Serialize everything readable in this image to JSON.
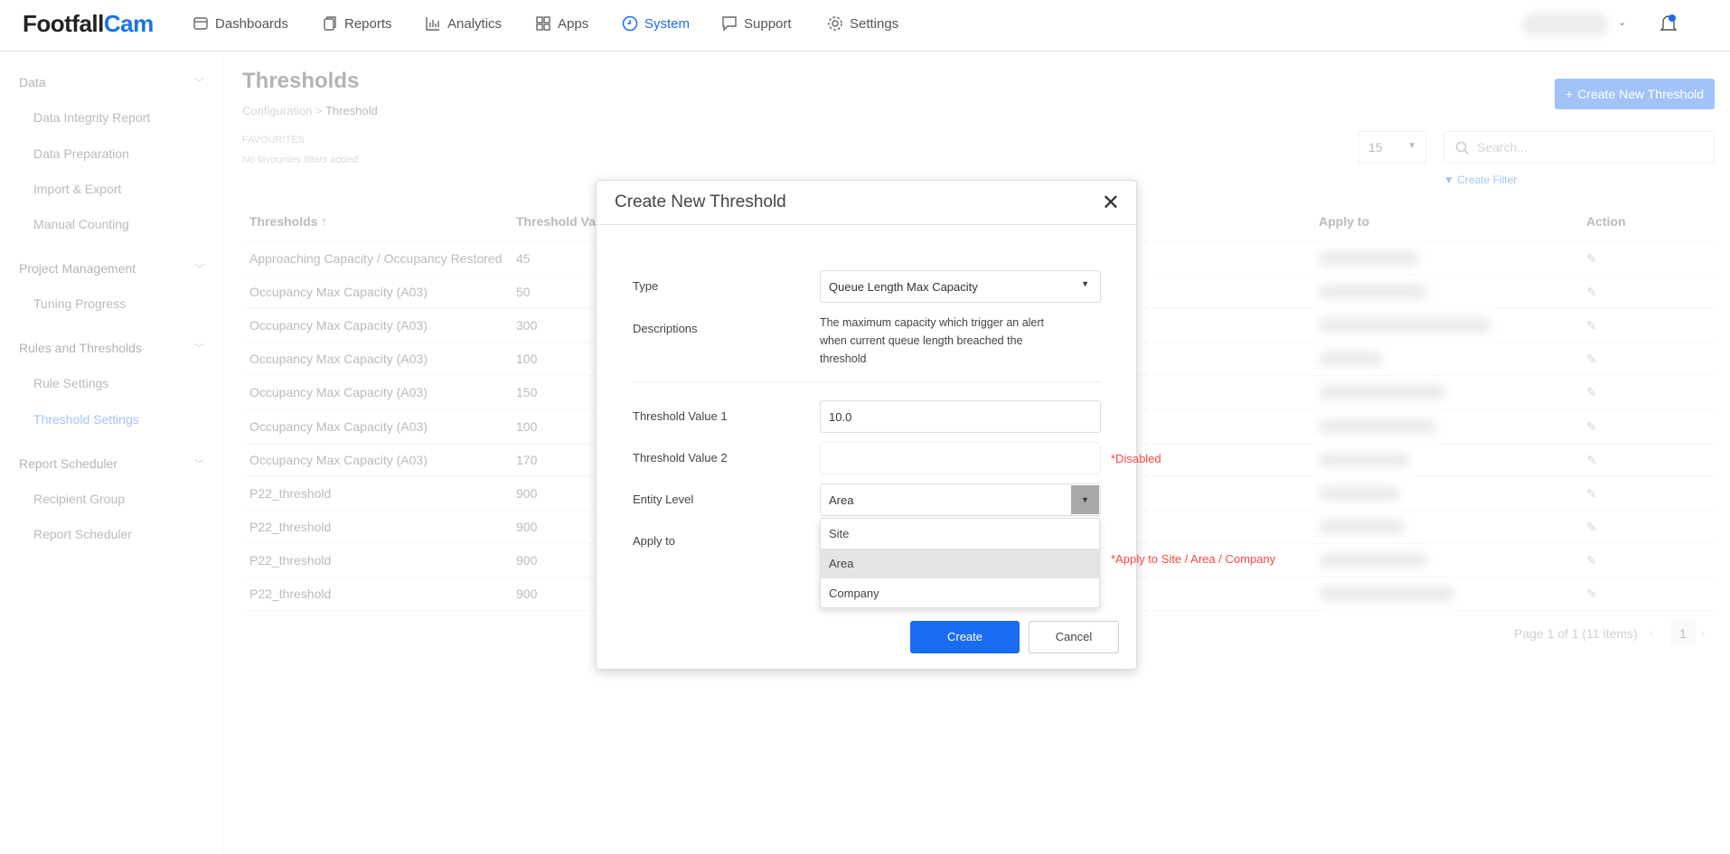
{
  "header": {
    "logo_a": "Footfall",
    "logo_b": "Cam",
    "nav": [
      {
        "label": "Dashboards",
        "icon": "dashboard-icon"
      },
      {
        "label": "Reports",
        "icon": "reports-icon"
      },
      {
        "label": "Analytics",
        "icon": "analytics-icon"
      },
      {
        "label": "Apps",
        "icon": "apps-icon"
      },
      {
        "label": "System",
        "icon": "system-icon",
        "active": true
      },
      {
        "label": "Support",
        "icon": "support-icon"
      },
      {
        "label": "Settings",
        "icon": "gear-icon"
      }
    ]
  },
  "sidebar": {
    "groups": [
      {
        "label": "Data",
        "items": [
          "Data Integrity Report",
          "Data Preparation",
          "Import & Export",
          "Manual Counting"
        ]
      },
      {
        "label": "Project Management",
        "items": [
          "Tuning Progress"
        ]
      },
      {
        "label": "Rules and Thresholds",
        "items": [
          "Rule Settings",
          "Threshold Settings"
        ]
      },
      {
        "label": "Report Scheduler",
        "items": [
          "Recipient Group",
          "Report Scheduler"
        ]
      }
    ],
    "active": "Threshold Settings"
  },
  "main": {
    "title": "Thresholds",
    "breadcrumb": [
      "Configuration",
      ">",
      "Threshold"
    ],
    "favourites_label": "FAVOURITES",
    "no_favourites": "No favourites filters added.",
    "create_button": "Create New Threshold",
    "page_size": "15",
    "search_placeholder": "Search...",
    "create_filter": "Create Filter",
    "columns": [
      "Thresholds",
      "Threshold Value",
      "Apply to",
      "Action"
    ],
    "rows": [
      [
        "Approaching Capacity / Occupancy Restored",
        "45"
      ],
      [
        "Occupancy Max Capacity (A03)",
        "50"
      ],
      [
        "Occupancy Max Capacity (A03)",
        "300"
      ],
      [
        "Occupancy Max Capacity (A03)",
        "100"
      ],
      [
        "Occupancy Max Capacity (A03)",
        "150"
      ],
      [
        "Occupancy Max Capacity (A03)",
        "100"
      ],
      [
        "Occupancy Max Capacity (A03)",
        "170"
      ],
      [
        "P22_threshold",
        "900"
      ],
      [
        "P22_threshold",
        "900"
      ],
      [
        "P22_threshold",
        "900"
      ],
      [
        "P22_threshold",
        "900"
      ]
    ],
    "pagination": "Page 1 of 1 (11 items)",
    "current_page": "1"
  },
  "dialog": {
    "title": "Create New Threshold",
    "type_label": "Type",
    "type_value": "Queue Length Max Capacity",
    "desc_label": "Descriptions",
    "desc_text": "The maximum capacity which trigger an alert when current queue length breached the threshold",
    "tv1_label": "Threshold Value 1",
    "tv1_value": "10.0",
    "tv2_label": "Threshold Value 2",
    "tv2_value": "",
    "tv2_note": "*Disabled",
    "entity_label": "Entity Level",
    "entity_value": "Area",
    "entity_options": [
      "Site",
      "Area",
      "Company"
    ],
    "apply_label": "Apply to",
    "apply_note": "*Apply to Site / Area / Company",
    "create": "Create",
    "cancel": "Cancel"
  },
  "colors": {
    "accent": "#1a6cf0",
    "error": "#ff4444"
  }
}
